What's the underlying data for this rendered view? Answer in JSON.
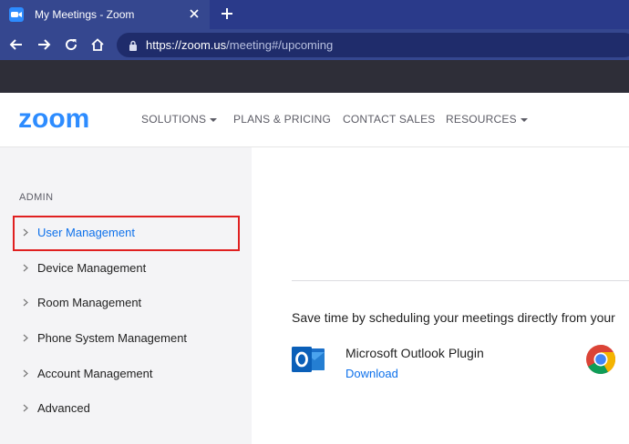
{
  "browser": {
    "tab_title": "My Meetings - Zoom",
    "url_host": "https://zoom.us",
    "url_path": "/meeting#/upcoming"
  },
  "header": {
    "logo": "zoom",
    "nav": [
      "SOLUTIONS",
      "PLANS & PRICING",
      "CONTACT SALES",
      "RESOURCES"
    ]
  },
  "sidebar": {
    "heading": "ADMIN",
    "items": [
      {
        "label": "User Management",
        "active": true
      },
      {
        "label": "Device Management"
      },
      {
        "label": "Room Management"
      },
      {
        "label": "Phone System Management"
      },
      {
        "label": "Account Management"
      },
      {
        "label": "Advanced"
      }
    ]
  },
  "main": {
    "promo_text": "Save time by scheduling your meetings directly from your",
    "plugin": {
      "name": "Microsoft Outlook Plugin",
      "action": "Download"
    }
  },
  "colors": {
    "brand": "#2d8cff",
    "link": "#0e71eb",
    "highlight": "#e02020",
    "browser_frame": "#35478f"
  }
}
